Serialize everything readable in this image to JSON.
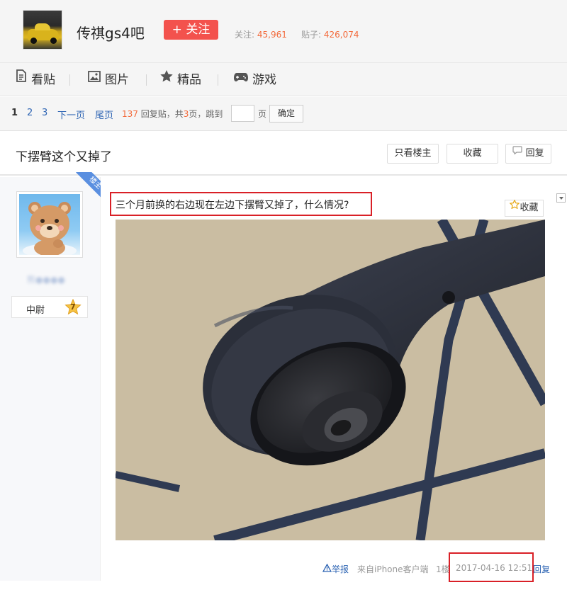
{
  "forum": {
    "name": "传祺gs4吧",
    "follow_label": "+ 关注",
    "follow_count_label": "关注:",
    "follow_count": "45,961",
    "post_count_label": "贴子:",
    "post_count": "426,074"
  },
  "nav": {
    "items": [
      {
        "label": "看贴",
        "icon": "document-icon"
      },
      {
        "label": "图片",
        "icon": "image-icon"
      },
      {
        "label": "精品",
        "icon": "star-icon"
      },
      {
        "label": "游戏",
        "icon": "gamepad-icon"
      }
    ]
  },
  "pager": {
    "pages": [
      "1",
      "2",
      "3"
    ],
    "next": "下一页",
    "last": "尾页",
    "reply_count": "137",
    "reply_label": "回复贴，共",
    "total_pages": "3",
    "pages_label": "页，跳到",
    "page_unit": "页",
    "ok": "确定"
  },
  "thread": {
    "title": "下摆臂这个又掉了",
    "only_op": "只看楼主",
    "favorite": "收藏",
    "reply": "回复"
  },
  "post": {
    "op_badge": "楼主",
    "username": "熊●●●●",
    "rank": "中尉",
    "level": "7",
    "content": "三个月前换的右边现在左边下摆臂又掉了，什么情况?",
    "favorite": "收藏",
    "report": "举报",
    "source": "来自iPhone客户端",
    "floor": "1楼",
    "time": "2017-04-16 12:51",
    "reply": "回复"
  },
  "colors": {
    "link": "#2d64b3",
    "follow_red": "#f3524d",
    "highlight_red": "#d92027"
  }
}
